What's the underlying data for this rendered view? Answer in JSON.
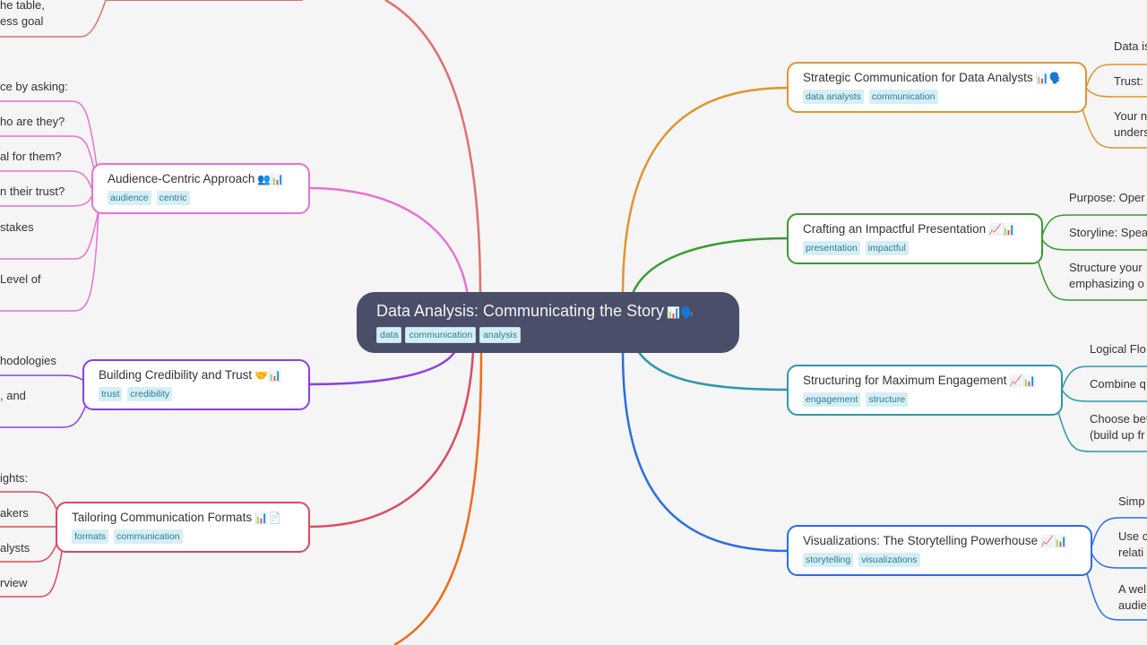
{
  "root": {
    "title": "Data Analysis: Communicating the Story",
    "emoji": "📊🗣️",
    "tags": [
      "data",
      "communication",
      "analysis"
    ]
  },
  "colors": {
    "strategic": "#e0952e",
    "crafting": "#3b9a32",
    "structuring": "#2b9aab",
    "visualizations": "#2a6ee6",
    "audience": "#e872d0",
    "credibility": "#8a3ee8",
    "tailoring": "#e0485e",
    "top_left": "#e07070",
    "bottom_left": "#f06a1a"
  },
  "right_branches": [
    {
      "title": "Strategic Communication for Data Analysts",
      "emoji": "📊🗣️",
      "tags": [
        "data analysts",
        "communication"
      ],
      "children": [
        "Data is",
        "Trust:",
        "Your n\nunders"
      ]
    },
    {
      "title": "Crafting an Impactful Presentation",
      "emoji": "📈📊",
      "tags": [
        "presentation",
        "impactful"
      ],
      "children": [
        "Purpose: Oper",
        "Storyline: Spea",
        "Structure your\nemphasizing o"
      ]
    },
    {
      "title": "Structuring for Maximum Engagement",
      "emoji": "📈📊",
      "tags": [
        "engagement",
        "structure"
      ],
      "children": [
        "Logical Flo",
        "Combine q",
        "Choose bet\n(build up fr"
      ]
    },
    {
      "title": "Visualizations: The Storytelling Powerhouse",
      "emoji": "📈📊",
      "tags": [
        "storytelling",
        "visualizations"
      ],
      "children": [
        "Simp",
        "Use c\nrelati",
        "A wel\naudie"
      ]
    }
  ],
  "left_branches": [
    {
      "title": "Audience-Centric Approach",
      "emoji": "👥📊",
      "tags": [
        "audience",
        "centric"
      ],
      "children": [
        "ce by asking:",
        "ho are they?",
        "al for them?",
        "n their trust?",
        "stakes",
        "Level of"
      ]
    },
    {
      "title": "Building Credibility and Trust",
      "emoji": "🤝📊",
      "tags": [
        "trust",
        "credibility"
      ],
      "children": [
        "hodologies",
        ", and"
      ]
    },
    {
      "title": "Tailoring Communication Formats",
      "emoji": "📊📄",
      "tags": [
        "formats",
        "communication"
      ],
      "children": [
        "ights:",
        "akers",
        "alysts",
        "rview"
      ]
    }
  ],
  "top_left_leaf": "he table,\ness goal"
}
